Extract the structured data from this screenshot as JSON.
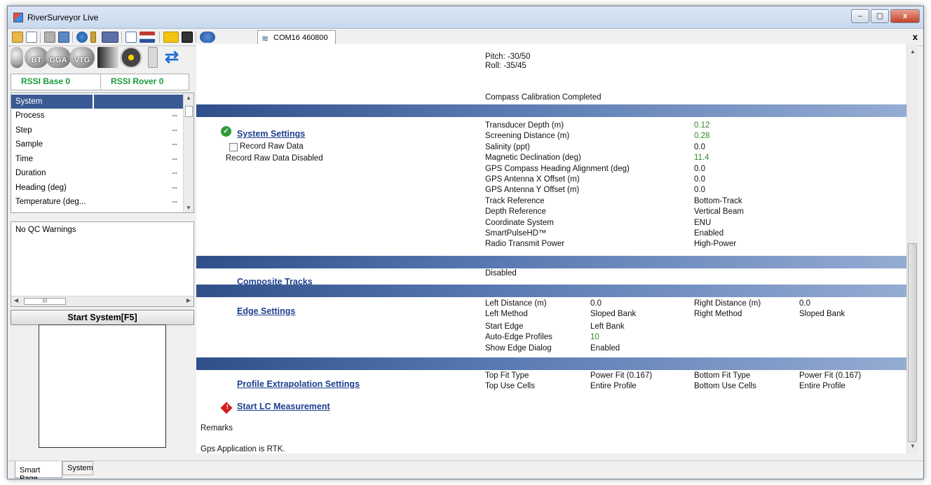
{
  "window": {
    "title": "RiverSurveyor Live",
    "minimize": "–",
    "maximize": "▢",
    "close": "x"
  },
  "toolbar": {
    "com_tab_label": "COM16 460800",
    "close_doc": "x"
  },
  "status_icons": [
    "bluetooth-icon",
    "BT",
    "GGA",
    "VTG",
    "sensor-bar-icon",
    "reel-icon",
    "battery-icon",
    "refresh-icon"
  ],
  "status_labels": {
    "bt": "BT",
    "gga": "GGA",
    "vtg": "VTG"
  },
  "rssi": {
    "base": "RSSI Base 0",
    "rover": "RSSI Rover 0"
  },
  "system_list": [
    {
      "label": "System",
      "value": ""
    },
    {
      "label": "Process",
      "value": "--"
    },
    {
      "label": "Step",
      "value": "--"
    },
    {
      "label": "Sample",
      "value": "--"
    },
    {
      "label": "Time",
      "value": "--"
    },
    {
      "label": "Duration",
      "value": "--"
    },
    {
      "label": "Heading (deg)",
      "value": "--"
    },
    {
      "label": "Temperature (deg...",
      "value": "--"
    }
  ],
  "qc": {
    "text": "No QC Warnings",
    "hscroll_grip": "III"
  },
  "start_system": "Start System[F5]",
  "main": {
    "pitch": "Pitch: -30/50",
    "roll": "Roll: -35/45",
    "compass_status": "Compass Calibration Completed",
    "system_settings": {
      "title": "System Settings",
      "record_raw_label": "Record Raw Data",
      "record_raw_status": "Record Raw Data Disabled",
      "rows": [
        {
          "label": "Transducer Depth (m)",
          "value": "0.12",
          "highlight": true
        },
        {
          "label": "Screening Distance (m)",
          "value": "0.28",
          "highlight": true
        },
        {
          "label": "Salinity (ppt)",
          "value": "0.0",
          "highlight": false
        },
        {
          "label": "Magnetic Declination (deg)",
          "value": "11.4",
          "highlight": true
        },
        {
          "label": "GPS Compass Heading Alignment (deg)",
          "value": "0.0",
          "highlight": false
        },
        {
          "label": "GPS Antenna X Offset (m)",
          "value": "0.0",
          "highlight": false
        },
        {
          "label": "GPS Antenna Y Offset (m)",
          "value": "0.0",
          "highlight": false
        },
        {
          "label": "Track Reference",
          "value": "Bottom-Track",
          "highlight": false
        },
        {
          "label": "Depth Reference",
          "value": "Vertical Beam",
          "highlight": false
        },
        {
          "label": "Coordinate System",
          "value": "ENU",
          "highlight": false
        },
        {
          "label": "SmartPulseHD™",
          "value": "Enabled",
          "highlight": false
        },
        {
          "label": "Radio Transmit Power",
          "value": "High-Power",
          "highlight": false
        }
      ]
    },
    "composite_tracks": {
      "title": "Composite Tracks",
      "value": "Disabled"
    },
    "edge_settings": {
      "title": "Edge Settings",
      "left_distance_label": "Left Distance (m)",
      "left_distance": "0.0",
      "left_method_label": "Left Method",
      "left_method": "Sloped Bank",
      "start_edge_label": "Start Edge",
      "start_edge": "Left Bank",
      "auto_edge_label": "Auto-Edge Profiles",
      "auto_edge": "10",
      "show_dialog_label": "Show Edge Dialog",
      "show_dialog": "Enabled",
      "right_distance_label": "Right Distance (m)",
      "right_distance": "0.0",
      "right_method_label": "Right Method",
      "right_method": "Sloped Bank"
    },
    "profile": {
      "title": "Profile Extrapolation Settings",
      "top_fit_label": "Top Fit Type",
      "top_fit": "Power Fit (0.167)",
      "top_cells_label": "Top Use Cells",
      "top_cells": "Entire Profile",
      "bottom_fit_label": "Bottom Fit Type",
      "bottom_fit": "Power Fit (0.167)",
      "bottom_cells_label": "Bottom Use Cells",
      "bottom_cells": "Entire Profile"
    },
    "start_lc": "Start LC Measurement",
    "remarks_label": "Remarks",
    "remarks_text": "Gps Application is RTK."
  },
  "tabs": {
    "smart_page": "Smart Page",
    "system": "System"
  },
  "colors": {
    "highlight_value": "#2e8b2e",
    "link": "#1e3f8f",
    "section_bar": "#2f4f8a",
    "rssi": "#1a9a3a"
  }
}
